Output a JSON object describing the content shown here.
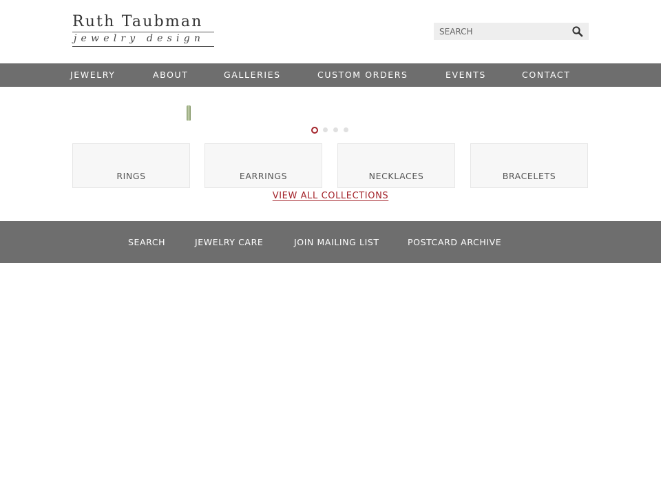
{
  "logo": {
    "line1": "Ruth Taubman",
    "line2": "jewelry design"
  },
  "search": {
    "placeholder": "SEARCH",
    "icon": "magnifier-icon"
  },
  "nav": {
    "items": [
      {
        "label": "JEWELRY"
      },
      {
        "label": "ABOUT"
      },
      {
        "label": "GALLERIES"
      },
      {
        "label": "CUSTOM ORDERS"
      },
      {
        "label": "EVENTS"
      },
      {
        "label": "CONTACT"
      }
    ]
  },
  "slider": {
    "slide_count": 4,
    "active_index": 0
  },
  "collections": {
    "items": [
      {
        "label": "RINGS"
      },
      {
        "label": "EARRINGS"
      },
      {
        "label": "NECKLACES"
      },
      {
        "label": "BRACELETS"
      }
    ],
    "view_all_label": "VIEW ALL COLLECTIONS"
  },
  "footer": {
    "items": [
      {
        "label": "SEARCH"
      },
      {
        "label": "JEWELRY CARE"
      },
      {
        "label": "JOIN MAILING LIST"
      },
      {
        "label": "POSTCARD ARCHIVE"
      }
    ]
  },
  "colors": {
    "nav_background": "#6e6e6e",
    "accent": "#a3232a",
    "tile_background": "#f7f7f7",
    "search_background": "#eeeeee"
  }
}
